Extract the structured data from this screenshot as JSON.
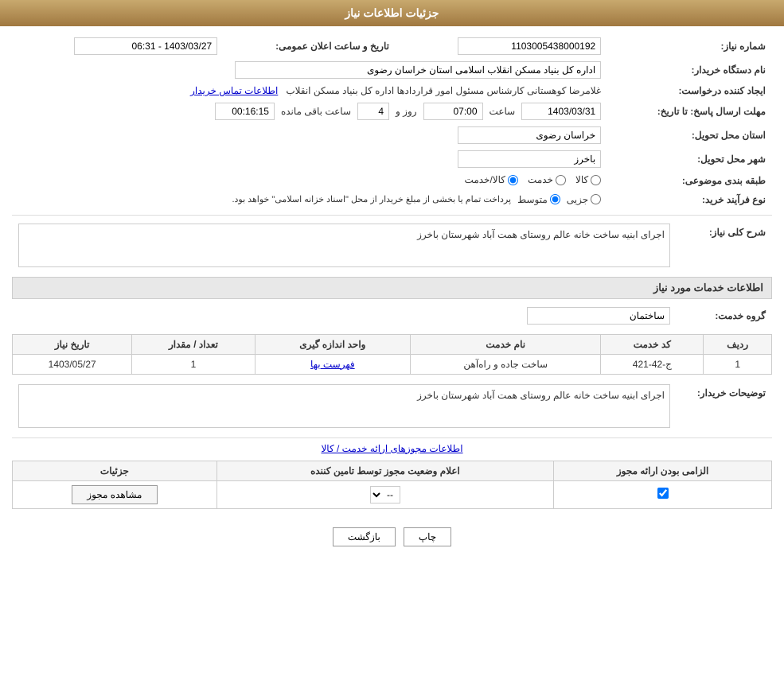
{
  "page": {
    "title": "جزئیات اطلاعات نیاز"
  },
  "fields": {
    "need_number_label": "شماره نیاز:",
    "need_number_value": "1103005438000192",
    "buyer_org_label": "نام دستگاه خریدار:",
    "buyer_org_value": "اداره کل بنیاد مسکن انقلاب اسلامی استان خراسان رضوی",
    "creator_label": "ایجاد کننده درخواست:",
    "creator_value": "غلامرضا کوهستانی کارشناس مسئول امور قراردادها اداره کل بنیاد مسکن انقلاب",
    "contact_link": "اطلاعات تماس خریدار",
    "announce_date_label": "تاریخ و ساعت اعلان عمومی:",
    "announce_date_value": "1403/03/27 - 06:31",
    "send_date_label": "مهلت ارسال پاسخ: تا تاریخ:",
    "send_date_value": "1403/03/31",
    "send_time_label": "ساعت",
    "send_time_value": "07:00",
    "send_days_label": "روز و",
    "send_days_value": "4",
    "send_remaining_label": "ساعت باقی مانده",
    "send_remaining_value": "00:16:15",
    "province_label": "استان محل تحویل:",
    "province_value": "خراسان رضوی",
    "city_label": "شهر محل تحویل:",
    "city_value": "باخرز",
    "category_label": "طبقه بندی موضوعی:",
    "category_options": [
      "کالا",
      "خدمت",
      "کالا/خدمت"
    ],
    "category_selected": "کالا",
    "purchase_type_label": "نوع فرآیند خرید:",
    "purchase_options": [
      "جزیی",
      "متوسط"
    ],
    "purchase_selected": "متوسط",
    "purchase_note": "پرداخت تمام یا بخشی از مبلغ خریدار از محل \"اسناد خزانه اسلامی\" خواهد بود.",
    "need_desc_label": "شرح کلی نیاز:",
    "need_desc_value": "اجرای ابنیه ساخت خانه عالم روستای همت آباد شهرستان باخرز",
    "services_section_label": "اطلاعات خدمات مورد نیاز",
    "service_group_label": "گروه خدمت:",
    "service_group_value": "ساختمان",
    "table": {
      "headers": [
        "ردیف",
        "کد خدمت",
        "نام خدمت",
        "واحد اندازه گیری",
        "تعداد / مقدار",
        "تاریخ نیاز"
      ],
      "rows": [
        {
          "index": "1",
          "code": "ج-42-421",
          "name": "ساخت جاده و راه‌آهن",
          "unit": "فهرست بها",
          "quantity": "1",
          "date": "1403/05/27"
        }
      ]
    },
    "buyer_desc_label": "توضیحات خریدار:",
    "buyer_desc_value": "اجرای ابنیه ساخت خانه عالم روستای همت آباد شهرستان باخرز",
    "permissions_link": "اطلاعات مجوزهای ارائه خدمت / کالا",
    "perm_table": {
      "headers": [
        "الزامی بودن ارائه مجوز",
        "اعلام وضعیت مجوز توسط تامین کننده",
        "جزئیات"
      ],
      "rows": [
        {
          "required": "checked",
          "status": "--",
          "details": "مشاهده مجوز"
        }
      ]
    },
    "buttons": {
      "print": "چاپ",
      "back": "بازگشت"
    }
  }
}
